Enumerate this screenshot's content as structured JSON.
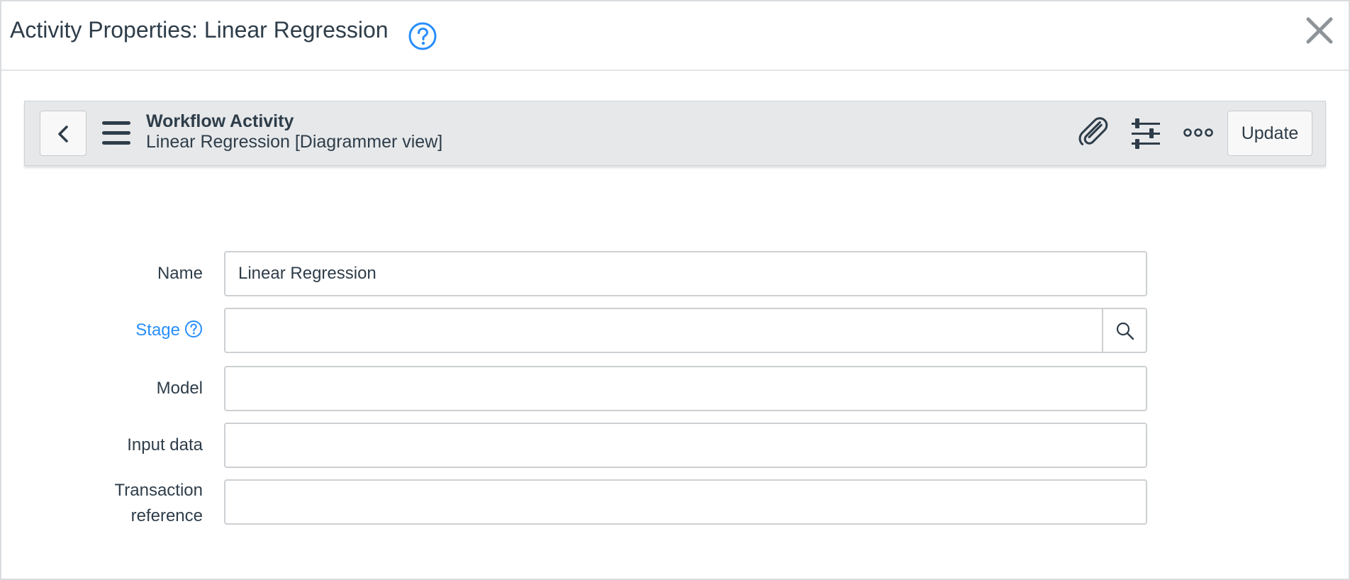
{
  "dialog": {
    "title": "Activity Properties: Linear Regression",
    "help_icon": "question-circle-icon",
    "close_icon": "close-x-icon"
  },
  "toolbar": {
    "back_icon": "chevron-left-icon",
    "menu_icon": "hamburger-menu-icon",
    "record_type": "Workflow Activity",
    "record_name": "Linear Regression [Diagrammer view]",
    "attachment_icon": "paperclip-icon",
    "personalize_icon": "sliders-icon",
    "more_icon": "more-options-icon",
    "update_label": "Update"
  },
  "form": {
    "name": {
      "label": "Name",
      "value": "Linear Regression"
    },
    "stage": {
      "label": "Stage",
      "value": "",
      "lookup_icon": "search-icon",
      "help_icon": "question-circle-icon"
    },
    "model": {
      "label": "Model",
      "value": ""
    },
    "input_data": {
      "label": "Input data",
      "value": ""
    },
    "transaction_reference": {
      "label_line1": "Transaction",
      "label_line2": "reference",
      "value": ""
    }
  },
  "colors": {
    "accent": "#278efc",
    "text": "#2e3d49",
    "toolbar_bg": "#e6e8ea",
    "border": "#cdd0d3"
  }
}
